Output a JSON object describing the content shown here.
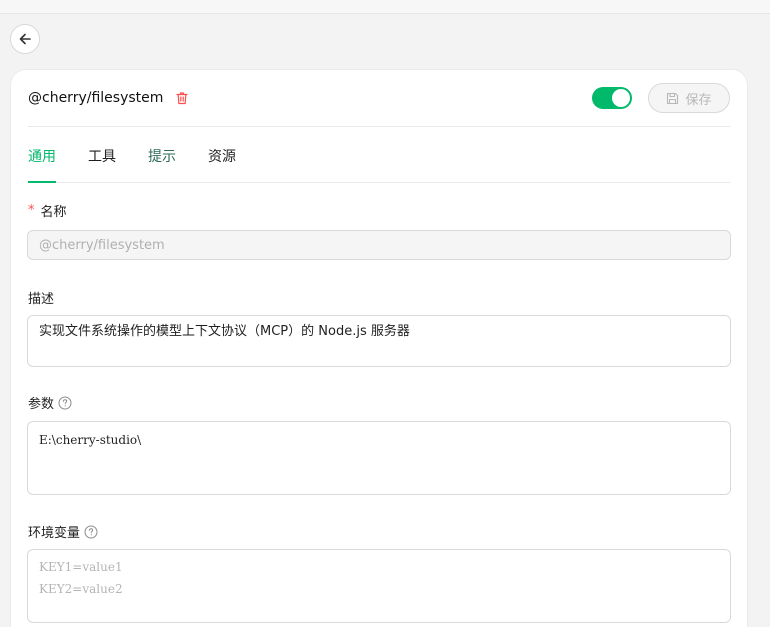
{
  "server": {
    "name": "@cherry/filesystem",
    "enabled": true,
    "save_label": "保存"
  },
  "tabs": [
    {
      "label": "通用",
      "active": true
    },
    {
      "label": "工具",
      "active": false
    },
    {
      "label": "提示",
      "active": false
    },
    {
      "label": "资源",
      "active": false
    }
  ],
  "form": {
    "name": {
      "required_mark": "*",
      "label": "名称",
      "value": "@cherry/filesystem"
    },
    "description": {
      "label": "描述",
      "value": "实现文件系统操作的模型上下文协议（MCP）的 Node.js 服务器"
    },
    "args": {
      "label": "参数",
      "value": "E:\\cherry-studio\\"
    },
    "env": {
      "label": "环境变量",
      "placeholder_line1": "KEY1=value1",
      "placeholder_line2": "KEY2=value2"
    }
  },
  "colors": {
    "accent": "#00b96b",
    "danger": "#ff4d4f"
  },
  "icons": {
    "back": "arrow-left-icon",
    "delete": "trash-icon",
    "save": "save-icon",
    "help": "question-circle-icon"
  }
}
